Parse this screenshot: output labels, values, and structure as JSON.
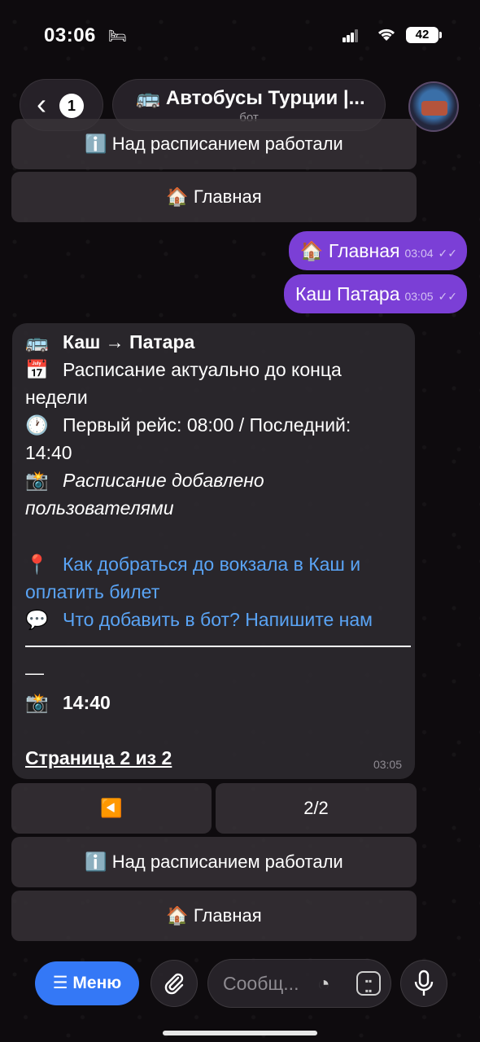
{
  "status_bar": {
    "time": "03:06",
    "battery": "42"
  },
  "header": {
    "back_badge": "1",
    "title": "🚌 Автобусы Турции |...",
    "subtitle": "бот"
  },
  "top_keyboard": {
    "info_label": "ℹ️ Над расписанием работали",
    "home_label": "🏠 Главная"
  },
  "outgoing": [
    {
      "text": "🏠 Главная",
      "time": "03:04"
    },
    {
      "text": "Каш Патара",
      "time": "03:05"
    }
  ],
  "bot_message": {
    "route_icon": "🚌",
    "route": "Каш → Патара",
    "calendar_icon": "📅",
    "actual_1": "Расписание актуально до конца",
    "actual_2": "недели",
    "clock_icon": "🕐",
    "first_last_1": "Первый рейс: 08:00 / Последний:",
    "first_last_2": "14:40",
    "camera_icon": "📸",
    "added_1": "Расписание добавлено",
    "added_2": "пользователями",
    "pin_icon": "📍",
    "link1_1": "Как добраться до вокзала в Каш и",
    "link1_2": "оплатить билет",
    "speech_icon": "💬",
    "link2": "Что добавить в бот? Напишите нам",
    "dash": "—",
    "schedule_time": "14:40",
    "page_label": "Страница 2 из 2",
    "time": "03:05"
  },
  "bottom_keyboard": {
    "prev_label": "◀️",
    "page_label": "2/2",
    "info_label": "ℹ️ Над расписанием работали",
    "home_label": "🏠 Главная"
  },
  "composer": {
    "menu_label": "☰ Меню",
    "placeholder": "Сообщ...",
    "attach_icon": "paperclip-icon",
    "mic_icon": "microphone-icon"
  }
}
